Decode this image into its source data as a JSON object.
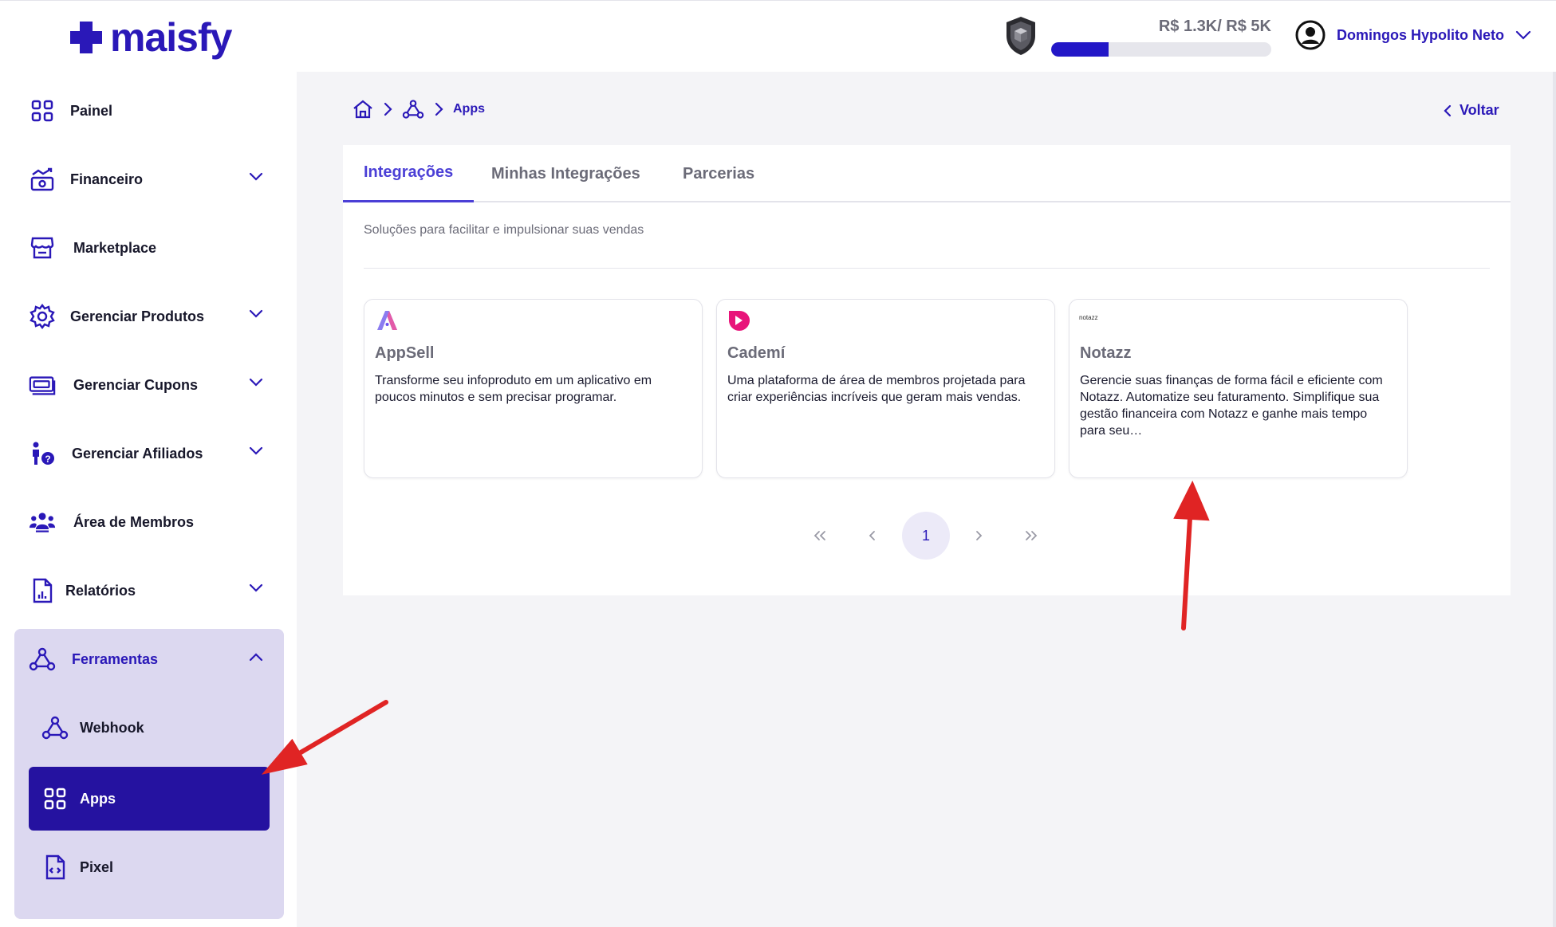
{
  "brand": {
    "name": "maisfy",
    "color": "#2a18b8"
  },
  "header": {
    "progress_text": "R$ 1.3K/ R$ 5K",
    "progress_fraction": 0.26,
    "user_name": "Domingos Hypolito Neto",
    "icons": {
      "badge": "shield-icon",
      "avatar": "user-avatar-icon",
      "menu": "chevron-down-icon"
    }
  },
  "sidebar": {
    "items": [
      {
        "label": "Painel",
        "icon": "grid-icon",
        "has_submenu": false
      },
      {
        "label": "Financeiro",
        "icon": "money-chart-icon",
        "has_submenu": true
      },
      {
        "label": "Marketplace",
        "icon": "store-icon",
        "has_submenu": false
      },
      {
        "label": "Gerenciar Produtos",
        "icon": "gear-icon",
        "has_submenu": true
      },
      {
        "label": "Gerenciar Cupons",
        "icon": "ticket-icon",
        "has_submenu": true
      },
      {
        "label": "Gerenciar Afiliados",
        "icon": "affiliate-icon",
        "has_submenu": true
      },
      {
        "label": "Área de Membros",
        "icon": "members-icon",
        "has_submenu": false
      },
      {
        "label": "Relatórios",
        "icon": "report-icon",
        "has_submenu": true
      }
    ],
    "tools": {
      "label": "Ferramentas",
      "icon": "webhook-icon",
      "expanded": true,
      "children": [
        {
          "label": "Webhook",
          "icon": "webhook-icon",
          "active": false
        },
        {
          "label": "Apps",
          "icon": "grid-icon",
          "active": true
        },
        {
          "label": "Pixel",
          "icon": "code-file-icon",
          "active": false
        }
      ]
    }
  },
  "breadcrumb": {
    "current": "Apps",
    "icons": [
      "home-icon",
      "webhook-icon"
    ]
  },
  "back_label": "Voltar",
  "tabs": [
    {
      "label": "Integrações",
      "active": true
    },
    {
      "label": "Minhas Integrações",
      "active": false
    },
    {
      "label": "Parcerias",
      "active": false
    }
  ],
  "subtitle": "Soluções para facilitar e impulsionar suas vendas",
  "cards": [
    {
      "name": "AppSell",
      "desc": "Transforme seu infoproduto em um aplicativo em poucos minutos e sem precisar programar.",
      "logo": "appsell-logo"
    },
    {
      "name": "Cademí",
      "desc": "Uma plataforma de área de membros projetada para criar experiências incríveis que geram mais vendas.",
      "logo": "cademi-logo"
    },
    {
      "name": "Notazz",
      "desc": "Gerencie suas finanças de forma fácil e eficiente com Notazz. Automatize seu faturamento. Simplifique sua gestão financeira com Notazz e ganhe mais tempo para seu…",
      "logo": "notazz-logo",
      "logo_text": "notazz"
    }
  ],
  "pagination": {
    "current": "1"
  },
  "colors": {
    "accent": "#2a18b8",
    "active_bg": "#2512a0",
    "tools_bg": "#dcd8f0",
    "annotation_arrow": "#e02424"
  }
}
